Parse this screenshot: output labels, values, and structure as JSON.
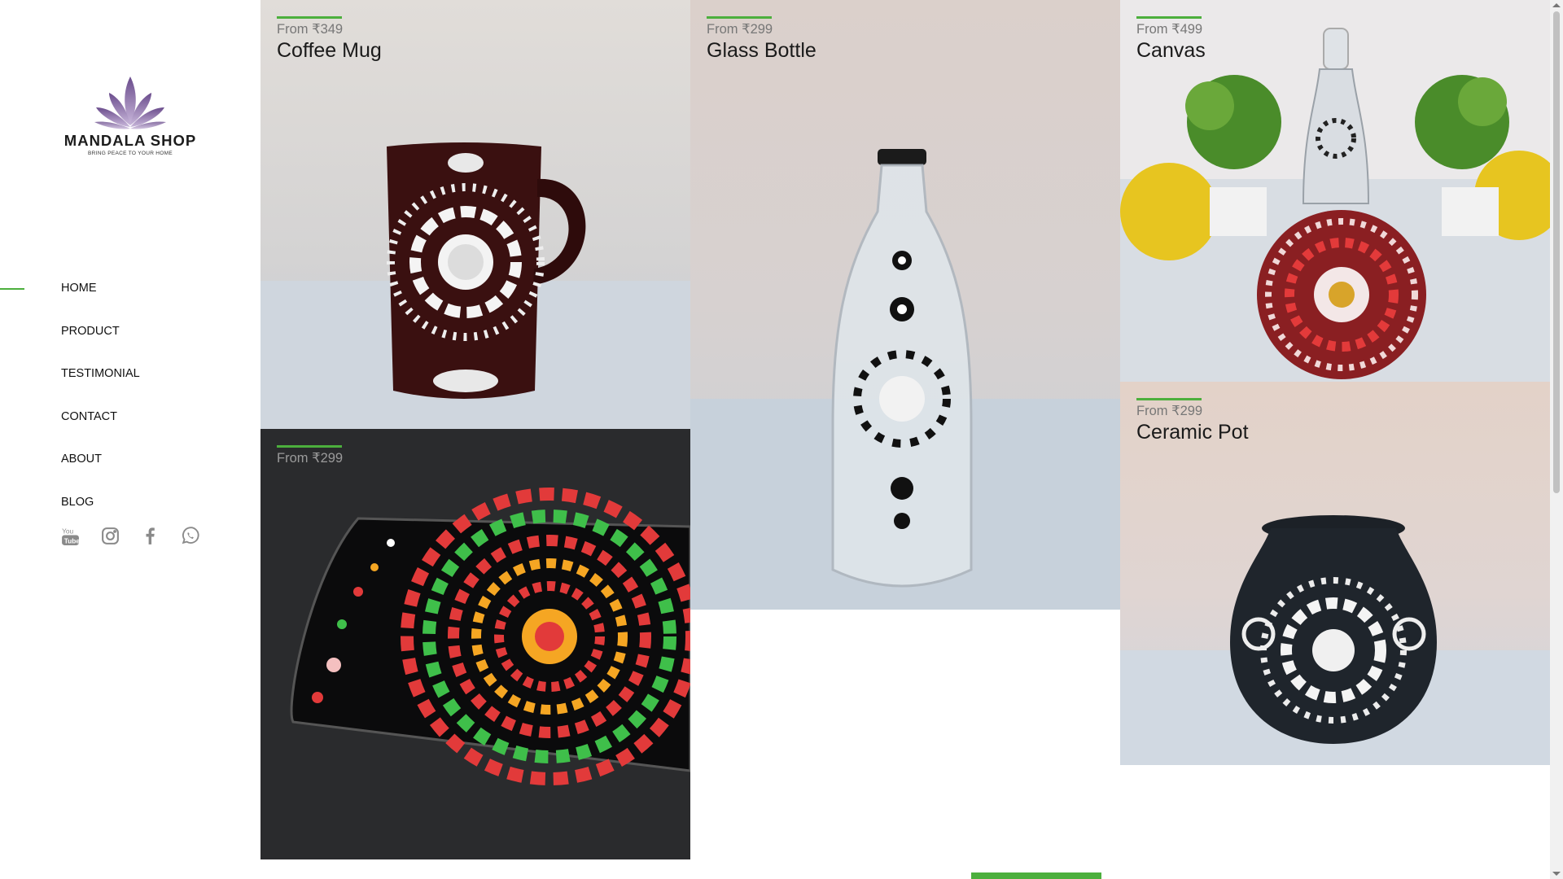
{
  "brand": {
    "name": "MANDALA SHOP",
    "tagline": "BRING PEACE TO YOUR HOME"
  },
  "nav": {
    "active": "HOME",
    "items": [
      {
        "label": "HOME"
      },
      {
        "label": "PRODUCT"
      },
      {
        "label": "TESTIMONIAL"
      },
      {
        "label": "CONTACT"
      },
      {
        "label": "ABOUT"
      },
      {
        "label": "BLOG"
      }
    ]
  },
  "social": [
    "youtube-icon",
    "instagram-icon",
    "facebook-icon",
    "whatsapp-icon"
  ],
  "products": [
    {
      "price": "From ₹349",
      "name": "Coffee Mug"
    },
    {
      "price": "From ₹299",
      "name": "Glass Bottle"
    },
    {
      "price": "From ₹499",
      "name": "Canvas"
    },
    {
      "price": "From ₹299",
      "name": "Ceramic Pot"
    },
    {
      "price": "From ₹299",
      "name": ""
    }
  ],
  "colors": {
    "accent": "#4caf3d",
    "text": "#111111",
    "muted": "#777777",
    "icon": "#8a8a8a"
  }
}
